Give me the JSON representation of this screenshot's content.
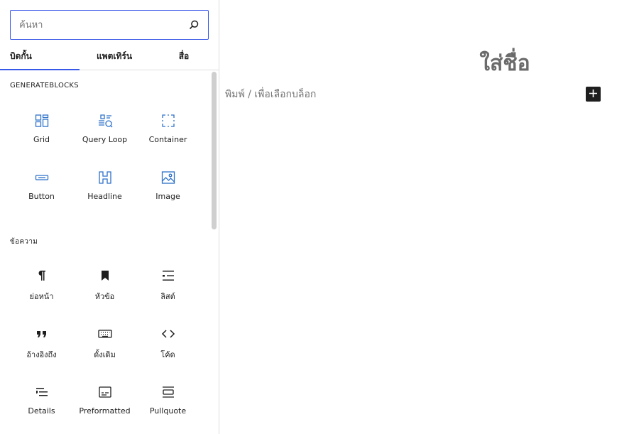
{
  "inserter": {
    "search": {
      "placeholder": "ค้นหา",
      "value": "",
      "icon": "search-icon"
    },
    "tabs": [
      {
        "label": "บิดกั้น",
        "active": true
      },
      {
        "label": "แพตเทิร์น",
        "active": false
      },
      {
        "label": "สื่อ",
        "active": false
      }
    ],
    "categories": [
      {
        "title": "GENERATEBLOCKS",
        "blocks": [
          {
            "label": "Grid",
            "icon": "grid-icon"
          },
          {
            "label": "Query Loop",
            "icon": "query-loop-icon"
          },
          {
            "label": "Container",
            "icon": "container-icon"
          },
          {
            "label": "Button",
            "icon": "button-icon"
          },
          {
            "label": "Headline",
            "icon": "headline-icon"
          },
          {
            "label": "Image",
            "icon": "image-icon"
          }
        ]
      },
      {
        "title": "ข้อความ",
        "blocks": [
          {
            "label": "ย่อหน้า",
            "icon": "paragraph-icon"
          },
          {
            "label": "หัวข้อ",
            "icon": "heading-icon"
          },
          {
            "label": "ลิสต์",
            "icon": "list-icon"
          },
          {
            "label": "อ้างอิงถึง",
            "icon": "quote-icon"
          },
          {
            "label": "ดั้งเดิม",
            "icon": "classic-icon"
          },
          {
            "label": "โค้ด",
            "icon": "code-icon"
          },
          {
            "label": "Details",
            "icon": "details-icon"
          },
          {
            "label": "Preformatted",
            "icon": "preformatted-icon"
          },
          {
            "label": "Pullquote",
            "icon": "pullquote-icon"
          }
        ]
      }
    ]
  },
  "editor": {
    "title_placeholder": "ใส่ชื่อ",
    "block_placeholder": "พิมพ์ / เพื่อเลือกบล็อก",
    "add_block_icon": "plus-icon"
  },
  "colors": {
    "accent": "#3858e9",
    "gb_icon": "#2c71c9",
    "text": "#1e1e1e",
    "muted": "#757575"
  }
}
